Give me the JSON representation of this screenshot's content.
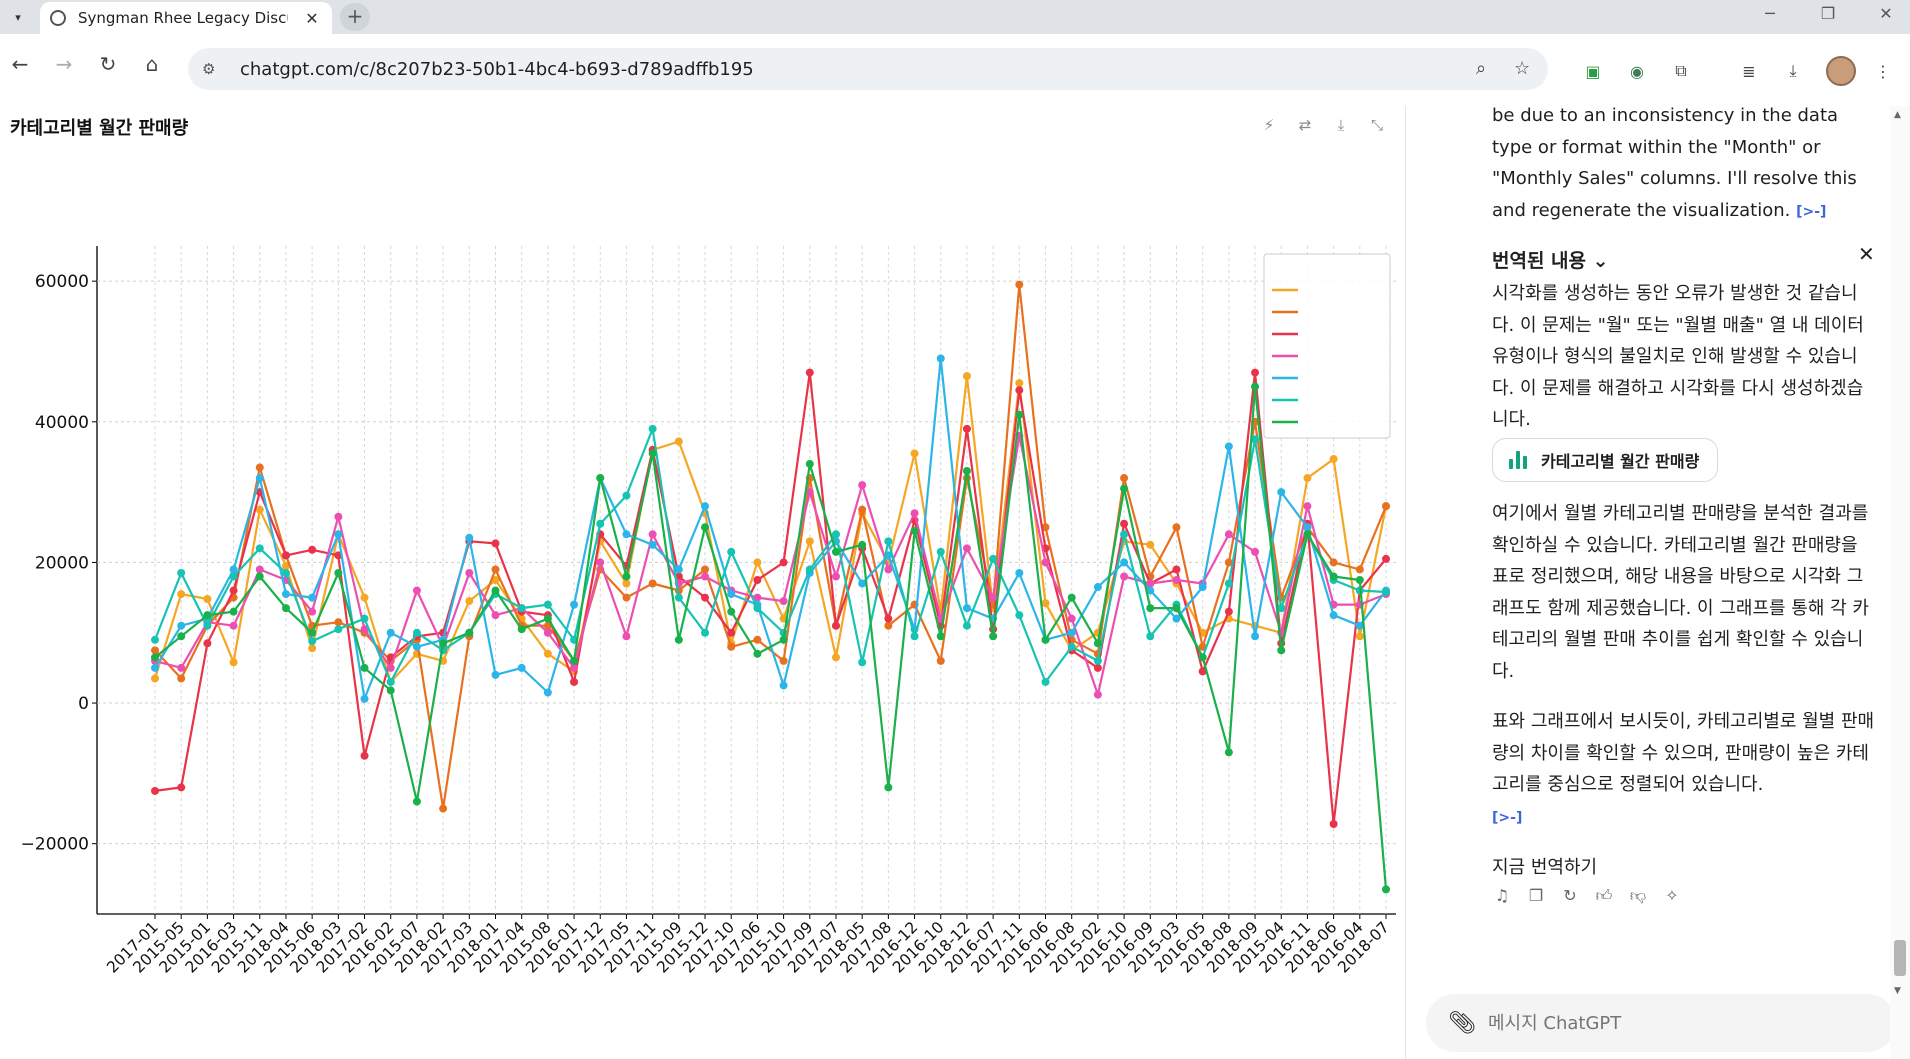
{
  "browser": {
    "tab_title": "Syngman Rhee Legacy Discuss",
    "url": "chatgpt.com/c/8c207b23-50b1-4bc4-b693-d789adffb195"
  },
  "panel": {
    "title": "카테고리별 월간 판매량"
  },
  "chat": {
    "intro_text": "be due to an inconsistency in the data type or format within the \"Month\" or \"Monthly Sales\" columns. I'll resolve this and regenerate the visualization.",
    "cite_label": "[>-]",
    "translation_header": "번역된 내용",
    "translation_text": "시각화를 생성하는 동안 오류가 발생한 것 같습니다. 이 문제는 \"월\" 또는 \"월별 매출\" 열 내 데이터 유형이나 형식의 불일치로 인해 발생할 수 있습니다. 이 문제를 해결하고 시각화를 다시 생성하겠습니다.",
    "chip_label": "카테고리별 월간 판매량",
    "paragraph1": "여기에서 월별 카테고리별 판매량을 분석한 결과를 확인하실 수 있습니다. 카테고리별 월간 판매량을 표로 정리했으며, 해당 내용을 바탕으로 시각화 그래프도 함께 제공했습니다. 이 그래프를 통해 각 카테고리의 월별 판매 추이를 쉽게 확인할 수 있습니다.",
    "paragraph2": "표와 그래프에서 보시듯이, 카테고리별로 월별 판매량의 차이를 확인할 수 있으며, 판매량이 높은 카테고리를 중심으로 정렬되어 있습니다.",
    "translate_now": "지금 번역하기",
    "composer_placeholder": "메시지 ChatGPT"
  },
  "chart_data": {
    "type": "line",
    "title": "",
    "xlabel": "",
    "ylabel": "",
    "ylim": [
      -30000,
      65000
    ],
    "yticks": [
      -20000,
      0,
      20000,
      40000,
      60000
    ],
    "ytick_labels": [
      "−20000",
      "0",
      "20000",
      "40000",
      "60000"
    ],
    "grid": true,
    "legend_placement": "top-right",
    "legend_title": "",
    "categories": [
      "2017-01",
      "2015-05",
      "2015-01",
      "2016-03",
      "2015-11",
      "2018-04",
      "2015-06",
      "2018-03",
      "2017-02",
      "2016-02",
      "2015-07",
      "2018-02",
      "2017-03",
      "2018-01",
      "2017-04",
      "2015-08",
      "2016-01",
      "2017-12",
      "2017-05",
      "2017-11",
      "2015-09",
      "2015-12",
      "2017-10",
      "2017-06",
      "2015-10",
      "2017-09",
      "2017-07",
      "2018-05",
      "2017-08",
      "2016-12",
      "2016-10",
      "2018-12",
      "2016-07",
      "2017-11",
      "2016-06",
      "2016-08",
      "2015-02",
      "2016-10",
      "2016-09",
      "2015-03",
      "2016-05",
      "2018-08",
      "2018-09",
      "2015-04",
      "2016-11",
      "2018-06",
      "2016-04",
      "2018-07"
    ],
    "series": [
      {
        "name": "",
        "color": "#f5a623",
        "values": [
          3500,
          15500,
          14800,
          5800,
          27500,
          19500,
          7800,
          24000,
          15000,
          3000,
          7000,
          6000,
          14500,
          17500,
          12000,
          7000,
          4500,
          23000,
          17000,
          36000,
          37200,
          27000,
          8500,
          20000,
          12000,
          23000,
          6500,
          27000,
          20000,
          35500,
          13000,
          46500,
          13500,
          45500,
          14200,
          7500,
          10000,
          23000,
          22500,
          17000,
          10000,
          12000,
          11000,
          10000,
          32000,
          34700,
          9500,
          28000
        ]
      },
      {
        "name": "",
        "color": "#e8701f",
        "values": [
          7500,
          3500,
          11000,
          15000,
          33500,
          21000,
          11000,
          11500,
          10000,
          6000,
          9000,
          -15000,
          9500,
          19000,
          11000,
          11000,
          6000,
          19000,
          15000,
          17000,
          16000,
          19000,
          8000,
          9000,
          6000,
          32000,
          11000,
          27500,
          11000,
          14000,
          6000,
          32000,
          14000,
          59500,
          25000,
          9000,
          7000,
          32000,
          18000,
          25000,
          8000,
          20000,
          40000,
          15000,
          25000,
          20000,
          19000,
          28000
        ]
      },
      {
        "name": "",
        "color": "#e8334a",
        "values": [
          -12500,
          -12000,
          8500,
          16000,
          30000,
          21000,
          21800,
          21000,
          -7500,
          6500,
          9500,
          10000,
          23000,
          22700,
          13000,
          12500,
          3000,
          24000,
          19500,
          36000,
          18000,
          15000,
          10000,
          17500,
          20000,
          47000,
          11000,
          22000,
          12000,
          26000,
          11000,
          39000,
          10500,
          44500,
          22000,
          7500,
          5000,
          25500,
          17000,
          19000,
          4500,
          13000,
          47000,
          8500,
          25500,
          -17200,
          16000,
          20500
        ]
      },
      {
        "name": "",
        "color": "#ec4fb2",
        "values": [
          6000,
          5000,
          11500,
          11000,
          19000,
          17500,
          13000,
          26500,
          10500,
          5000,
          16000,
          8000,
          18500,
          12500,
          13500,
          10000,
          5000,
          20000,
          9500,
          24000,
          17000,
          18000,
          16000,
          15000,
          14500,
          30000,
          18000,
          31000,
          19000,
          27000,
          12000,
          22000,
          15000,
          38000,
          20000,
          12000,
          1200,
          18000,
          17000,
          17500,
          17000,
          24000,
          21500,
          10000,
          28000,
          14000,
          14000,
          15500
        ]
      },
      {
        "name": "",
        "color": "#2cb5e8",
        "values": [
          5000,
          11000,
          12000,
          19000,
          32000,
          15500,
          15000,
          24000,
          600,
          10000,
          8000,
          9000,
          23500,
          4000,
          5000,
          1500,
          14000,
          32000,
          24000,
          22500,
          19000,
          28000,
          15500,
          14000,
          2500,
          18500,
          23000,
          17000,
          21000,
          10500,
          49000,
          13500,
          12000,
          18500,
          9000,
          10000,
          16500,
          20000,
          16000,
          12000,
          16500,
          36500,
          9500,
          30000,
          25000,
          12500,
          11000,
          16000
        ]
      },
      {
        "name": "",
        "color": "#17c3b2",
        "values": [
          9000,
          18500,
          11000,
          18000,
          22000,
          18500,
          8800,
          10500,
          12000,
          3000,
          10000,
          7500,
          10000,
          15500,
          13500,
          14000,
          9000,
          25500,
          29500,
          39000,
          15000,
          10000,
          21500,
          13500,
          10000,
          19000,
          24000,
          5800,
          23000,
          9500,
          21500,
          11000,
          20500,
          12500,
          3000,
          8000,
          6000,
          24000,
          9500,
          14000,
          6500,
          17000,
          37500,
          13500,
          24000,
          17500,
          16000,
          15800
        ]
      },
      {
        "name": "",
        "color": "#1ab04a",
        "values": [
          6500,
          9500,
          12500,
          13000,
          18000,
          13500,
          10000,
          18500,
          5000,
          1800,
          -14000,
          8500,
          10000,
          16000,
          10500,
          12000,
          6000,
          32000,
          18000,
          35500,
          9000,
          25000,
          13000,
          7000,
          9000,
          34000,
          21500,
          22500,
          -12000,
          24500,
          9500,
          33000,
          9500,
          41000,
          9000,
          15000,
          8500,
          30500,
          13500,
          13500,
          6500,
          -7000,
          45000,
          7500,
          24000,
          18000,
          17500,
          -26500
        ]
      }
    ]
  }
}
